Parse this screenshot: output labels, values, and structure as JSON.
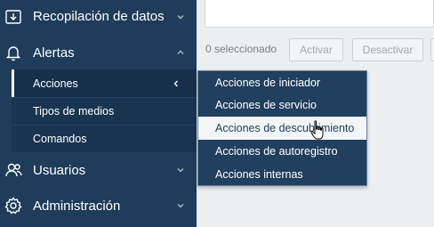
{
  "sidebar": {
    "items": [
      {
        "label": "Recopilación de datos",
        "icon": "data-collection-icon"
      },
      {
        "label": "Alertas",
        "icon": "bell-icon"
      },
      {
        "label": "Usuarios",
        "icon": "users-icon"
      },
      {
        "label": "Administración",
        "icon": "gear-icon"
      }
    ],
    "alertas_submenu": [
      {
        "label": "Acciones"
      },
      {
        "label": "Tipos de medios"
      },
      {
        "label": "Comandos"
      }
    ]
  },
  "toolbar": {
    "selected_count": "0 seleccionado",
    "activate_label": "Activar",
    "deactivate_label": "Desactivar"
  },
  "flyout_menu": {
    "items": [
      {
        "label": "Acciones de iniciador"
      },
      {
        "label": "Acciones de servicio"
      },
      {
        "label": "Acciones de descubrimiento"
      },
      {
        "label": "Acciones de autoregistro"
      },
      {
        "label": "Acciones internas"
      }
    ],
    "hovered": "Acciones de descubrimiento"
  },
  "colors": {
    "sidebar_bg": "#1f3c5a",
    "submenu_bg": "#193450",
    "menu_bg": "#213f5e",
    "page_bg": "#eceef0",
    "hover_bg": "#f3f5f7"
  }
}
